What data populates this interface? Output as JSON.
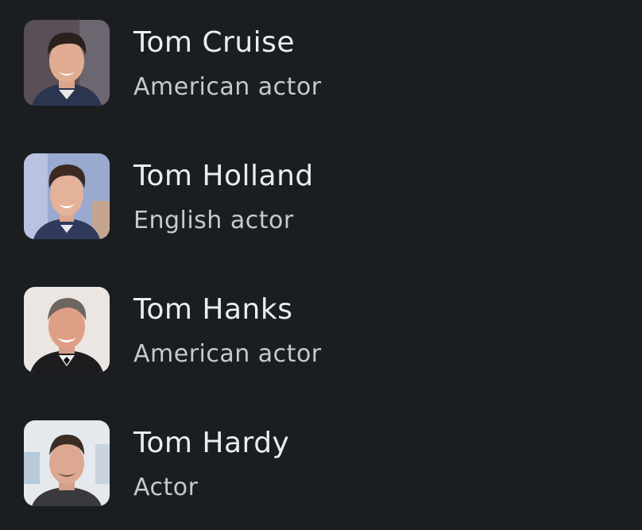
{
  "results": [
    {
      "name": "Tom Cruise",
      "description": "American actor",
      "image_icon": "person-photo-icon"
    },
    {
      "name": "Tom Holland",
      "description": "English actor",
      "image_icon": "person-photo-icon"
    },
    {
      "name": "Tom Hanks",
      "description": "American actor",
      "image_icon": "person-photo-icon"
    },
    {
      "name": "Tom Hardy",
      "description": "Actor",
      "image_icon": "person-photo-icon"
    }
  ],
  "colors": {
    "background": "#1b1e21",
    "name_text": "#ecedef",
    "description_text": "#c7c9cc"
  }
}
